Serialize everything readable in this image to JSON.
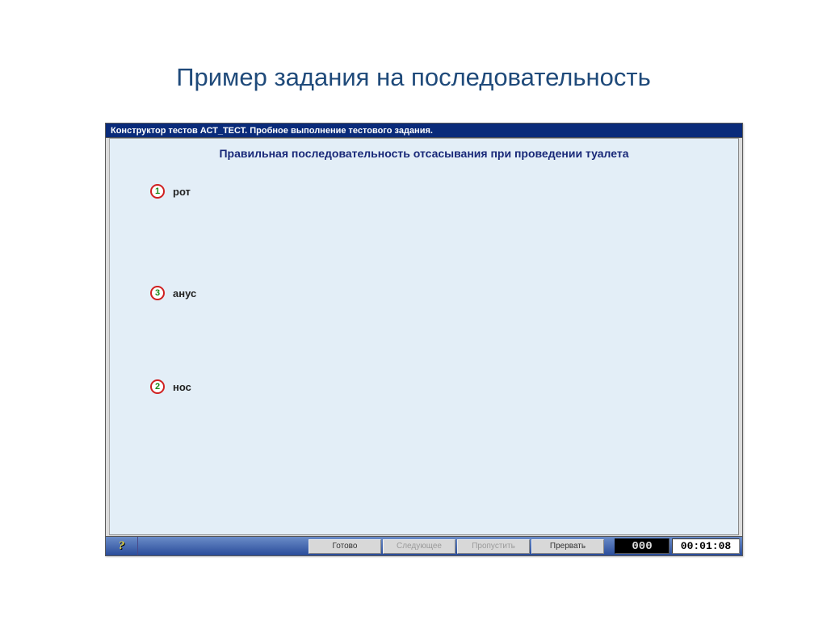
{
  "slide": {
    "title": "Пример задания на последовательность"
  },
  "window": {
    "titlebar": "Конструктор тестов АСТ_ТЕСТ. Пробное выполнение тестового задания.",
    "question": "Правильная последовательность отсасывания при проведении туалета"
  },
  "answers": [
    {
      "num": "1",
      "label": "рот"
    },
    {
      "num": "3",
      "label": "анус"
    },
    {
      "num": "2",
      "label": "нос"
    }
  ],
  "buttons": {
    "help": "?",
    "ready": "Готово",
    "next": "Следующее",
    "skip": "Пропустить",
    "abort": "Прервать"
  },
  "status": {
    "counter": "000",
    "timer": "00:01:08"
  }
}
